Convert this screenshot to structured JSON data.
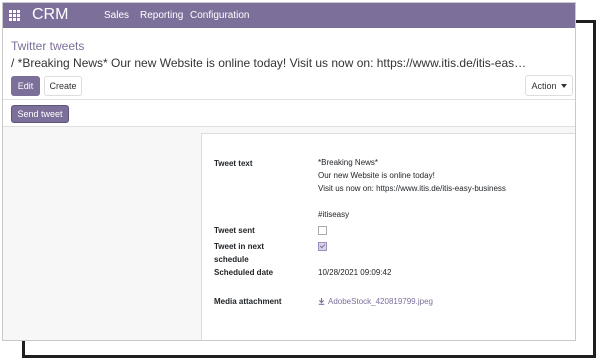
{
  "navbar": {
    "brand": "CRM",
    "menu": [
      "Sales",
      "Reporting",
      "Configuration"
    ]
  },
  "breadcrumb": {
    "parent": "Twitter tweets",
    "current": " / *Breaking News* Our new Website is online today! Visit us now on: https://www.itis.de/itis-eas…"
  },
  "buttons": {
    "edit": "Edit",
    "create": "Create",
    "action": "Action",
    "send_tweet": "Send tweet"
  },
  "form": {
    "tweet_text_label": "Tweet text",
    "tweet_text_lines": [
      "*Breaking News*",
      "Our new Website is online today!",
      "Visit us now on:  https://www.itis.de/itis-easy-business",
      "",
      "#itiseasy"
    ],
    "tweet_sent_label": "Tweet sent",
    "tweet_sent": false,
    "next_schedule_label_1": "Tweet in next",
    "next_schedule_label_2": "schedule",
    "tweet_in_next_schedule": true,
    "scheduled_date_label": "Scheduled date",
    "scheduled_date": "10/28/2021 09:09:42",
    "media_label": "Media attachment",
    "media_file": "AdobeStock_420819799.jpeg"
  },
  "icons": {
    "apps": "apps-grid-icon",
    "caret": "caret-down-icon",
    "download": "download-icon"
  },
  "colors": {
    "brand": "#7c6f9a"
  }
}
